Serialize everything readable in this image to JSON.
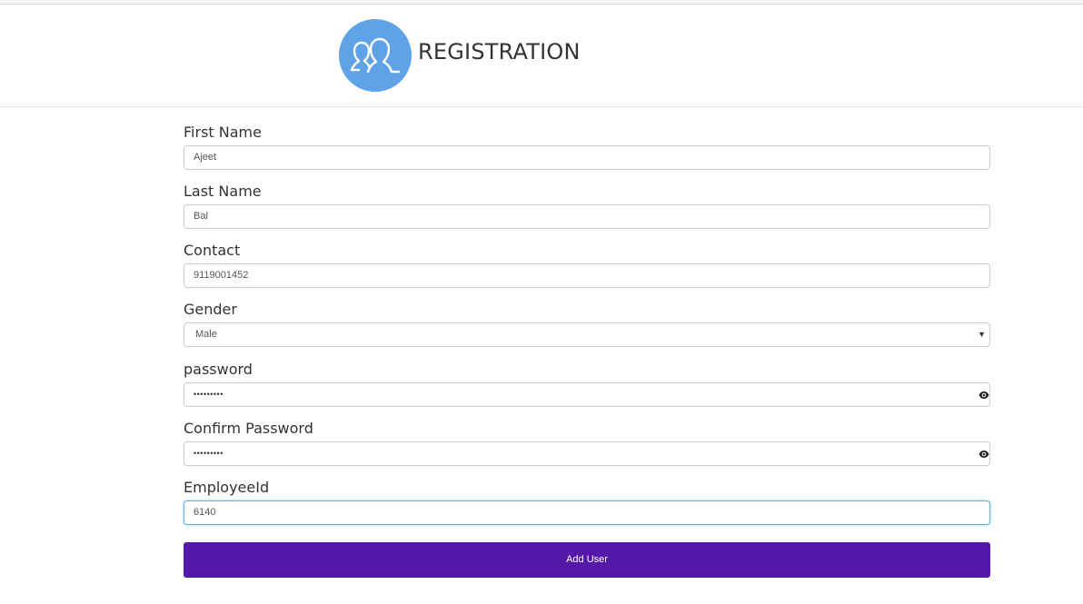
{
  "header": {
    "title": "REGISTRATION",
    "logo_icon": "users-icon",
    "logo_color": "#5fa3e6"
  },
  "form": {
    "first_name": {
      "label": "First Name",
      "value": "Ajeet"
    },
    "last_name": {
      "label": "Last Name",
      "value": "Bal"
    },
    "contact": {
      "label": "Contact",
      "value": "9119001452"
    },
    "gender": {
      "label": "Gender",
      "selected": "Male"
    },
    "password": {
      "label": "password",
      "masked_value": "•••••••••",
      "icon": "eye-icon"
    },
    "confirm_password": {
      "label": "Confirm Password",
      "masked_value": "•••••••••",
      "icon": "eye-icon"
    },
    "employee_id": {
      "label": "EmployeeId",
      "value": "6140"
    },
    "submit_label": "Add User",
    "submit_color": "#5418a8"
  }
}
